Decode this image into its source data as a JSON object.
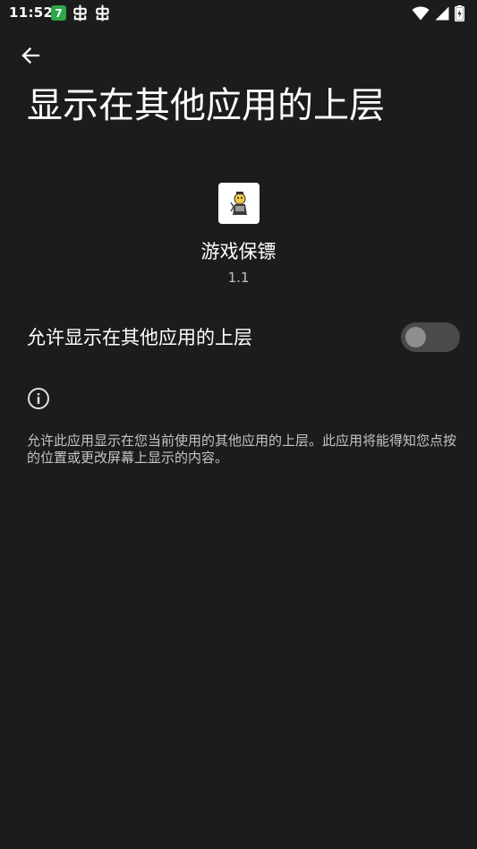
{
  "status_bar": {
    "time": "11:52",
    "notification_app_glyph": "7",
    "icons": [
      "wifi-icon",
      "signal-icon",
      "battery-charging-icon"
    ]
  },
  "header": {
    "back_icon": "arrow-left-icon",
    "title": "显示在其他应用的上层"
  },
  "app": {
    "name": "游戏保镖",
    "version": "1.1"
  },
  "permission": {
    "label": "允许显示在其他应用的上层",
    "enabled": false
  },
  "info": {
    "icon": "info-icon",
    "description": "允许此应用显示在您当前使用的其他应用的上层。此应用将能得知您点按的位置或更改屏幕上显示的内容。"
  },
  "colors": {
    "background": "#1c1c1c",
    "switch_track_off": "#4a4a4a",
    "switch_thumb_off": "#8e8e8e",
    "notification_green": "#2ea84a"
  }
}
